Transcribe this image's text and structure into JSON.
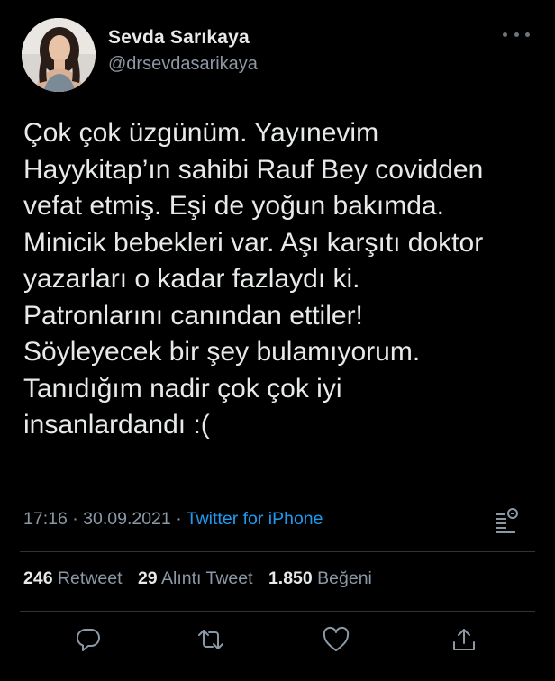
{
  "user": {
    "display_name": "Sevda Sarıkaya",
    "handle": "@drsevdasarikaya"
  },
  "tweet": {
    "lines": [
      "Çok çok üzgünüm. Yayınevim",
      "Hayykitap’ın sahibi Rauf Bey covidden",
      "vefat etmiş. Eşi de yoğun bakımda.",
      "Minicik bebekleri var. Aşı karşıtı doktor",
      "yazarları o kadar fazlaydı ki.",
      "Patronlarını canından ettiler!",
      "Söyleyecek bir şey bulamıyorum.",
      "Tanıdığım nadir çok çok iyi",
      "insanlardandı :("
    ]
  },
  "meta": {
    "time": "17:16",
    "separator": "·",
    "date": "30.09.2021",
    "source": "Twitter for iPhone"
  },
  "stats": {
    "retweets_count": "246",
    "retweets_label": "Retweet",
    "quotes_count": "29",
    "quotes_label": "Alıntı Tweet",
    "likes_count": "1.850",
    "likes_label": "Beğeni"
  },
  "icons": {
    "more": "more-horizontal-icon",
    "analytics": "analytics-icon",
    "reply": "reply-icon",
    "retweet": "retweet-icon",
    "like": "heart-icon",
    "share": "share-icon"
  },
  "colors": {
    "background": "#000000",
    "text": "#e7e9ea",
    "secondary": "#8b98a5",
    "link": "#1d9bf0",
    "divider": "#2f3336"
  }
}
